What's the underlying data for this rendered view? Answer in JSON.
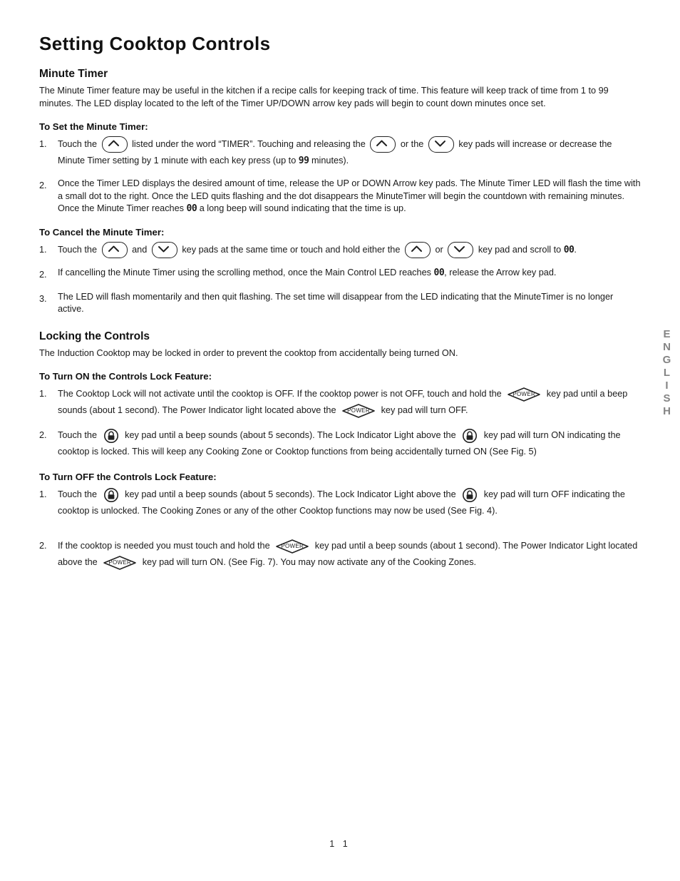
{
  "page": {
    "title": "Setting Cooktop Controls",
    "folio": "1 1",
    "side_tab": "ENGLISH"
  },
  "minute_timer": {
    "heading": "Minute Timer",
    "intro": "The Minute Timer feature may be useful in the kitchen if a recipe calls for keeping track of time. This feature will keep track of time from 1 to 99 minutes. The LED display located to the left of the Timer UP/DOWN arrow key pads will begin to count down minutes once set.",
    "set_heading": "To Set the Minute Timer:",
    "set_steps": [
      {
        "num": "1.",
        "t1": "Touch the",
        "t2": "listed under the word “TIMER”. Touching and releasing the",
        "t3": "or the",
        "t4": "key pads will increase or decrease the Minute Timer setting by 1 minute with each key press (up to",
        "seg": "99",
        "t5": "minutes)."
      },
      {
        "num": "2.",
        "t1": "Once the Timer LED displays the desired amount of time, release the UP or DOWN Arrow key pads. The Minute Timer LED will flash the time with a small dot to the right. Once the LED quits flashing and the dot disappears the MinuteTimer will begin the countdown with remaining minutes. Once the Minute Timer reaches",
        "seg": "00",
        "t2": "a long beep will sound indicating that the time is up."
      }
    ],
    "cancel_heading": "To Cancel the Minute Timer:",
    "cancel_steps": [
      {
        "num": "1.",
        "t1": "Touch the",
        "t2": "and",
        "t3": "key pads at the same time or touch and hold either the",
        "t4": "or",
        "t5": "key pad and scroll to",
        "seg": "00",
        "t6": "."
      },
      {
        "num": "2.",
        "t1": "If cancelling the Minute Timer using the scrolling method, once the Main Control LED reaches",
        "seg": "00",
        "t2": ", release the Arrow key pad."
      },
      {
        "num": "3.",
        "t1": "The LED will flash momentarily and then quit flashing. The set time will disappear from the LED indicating that the MinuteTimer is no longer active."
      }
    ]
  },
  "locking": {
    "heading": "Locking the Controls",
    "intro": "The Induction Cooktop may be locked in order to prevent the cooktop from accidentally being turned ON.",
    "on_heading": "To Turn ON the Controls Lock Feature:",
    "on_steps": [
      {
        "num": "1.",
        "t1": "The Cooktop Lock will not activate until the cooktop is OFF. If the cooktop power is not OFF, touch and hold the",
        "t2": "key pad until a beep sounds (about 1 second). The Power Indicator light located above the",
        "t3": "key pad will turn OFF."
      },
      {
        "num": "2.",
        "t1": "Touch the",
        "t2": "key pad until a beep sounds (about 5 seconds). The Lock Indicator Light above the",
        "t3": "key pad will turn ON indicating the cooktop is locked. This will keep any Cooking Zone or Cooktop functions from being accidentally turned ON (See Fig. 5)"
      }
    ],
    "off_heading": "To Turn OFF the Controls Lock Feature:",
    "off_steps": [
      {
        "num": "1.",
        "t1": "Touch the",
        "t2": "key pad until a beep sounds (about 5 seconds). The Lock Indicator Light above the",
        "t3": "key pad will turn OFF indicating the cooktop is unlocked. The Cooking Zones or any of the other Cooktop functions may now be used (See Fig. 4)."
      },
      {
        "num": "2.",
        "t1": "If the cooktop is needed you must touch and hold the",
        "t2": "key pad until a beep sounds (about 1 second). The Power Indicator Light located above the",
        "t3": "key pad will turn ON. (See Fig. 7).  You may now activate any of the Cooking Zones."
      }
    ]
  },
  "icons": {
    "up_arrow": "up-arrow-keypad-icon",
    "down_arrow": "down-arrow-keypad-icon",
    "power": "POWER",
    "lock": "lock-keypad-icon"
  }
}
